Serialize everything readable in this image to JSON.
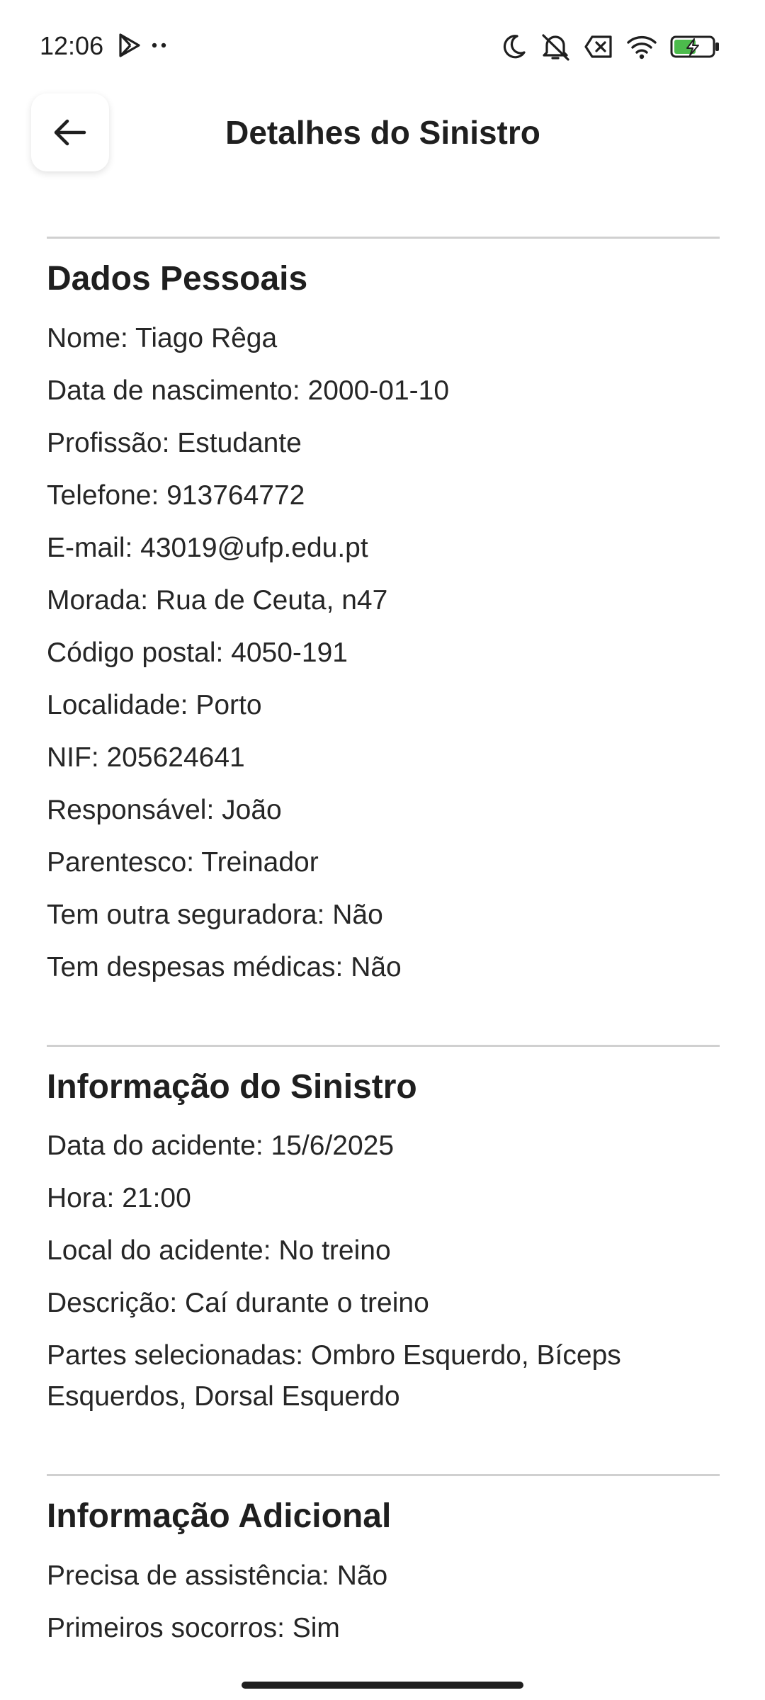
{
  "status_bar": {
    "time": "12:06",
    "left_icons": [
      "play-store-icon",
      "more-dots-icon"
    ],
    "right_icons": [
      "moon-icon",
      "mute-icon",
      "cancel-box-icon",
      "wifi-icon",
      "battery-charging-icon"
    ]
  },
  "app_bar": {
    "title": "Detalhes do Sinistro",
    "back_icon": "arrow-left-icon"
  },
  "sections": {
    "personal": {
      "title": "Dados Pessoais",
      "rows": [
        "Nome: Tiago Rêga",
        "Data de nascimento: 2000-01-10",
        "Profissão: Estudante",
        "Telefone: 913764772",
        "E-mail: 43019@ufp.edu.pt",
        "Morada: Rua de Ceuta, n47",
        "Código postal: 4050-191",
        "Localidade: Porto",
        "NIF: 205624641",
        "Responsável: João",
        "Parentesco: Treinador",
        "Tem outra seguradora: Não",
        "Tem despesas médicas: Não"
      ]
    },
    "claim": {
      "title": "Informação do Sinistro",
      "rows": [
        "Data do acidente: 15/6/2025",
        "Hora: 21:00",
        "Local do acidente: No treino",
        "Descrição: Caí durante o treino",
        "Partes selecionadas: Ombro Esquerdo, Bíceps Esquerdos, Dorsal Esquerdo"
      ]
    },
    "additional": {
      "title": "Informação Adicional",
      "rows": [
        "Precisa de assistência: Não",
        "Primeiros socorros: Sim"
      ]
    }
  }
}
